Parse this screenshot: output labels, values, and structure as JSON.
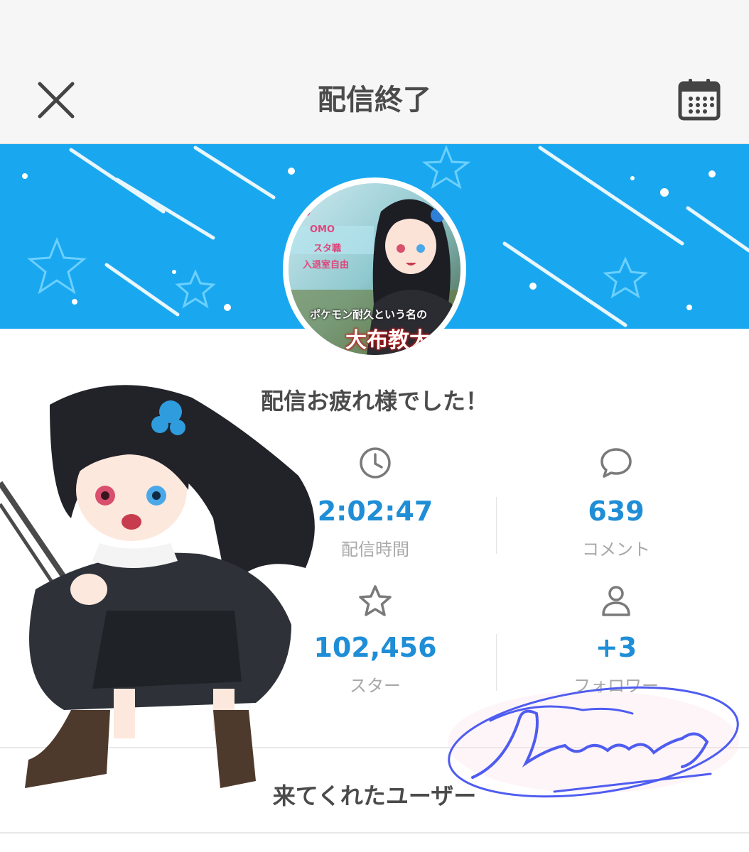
{
  "header": {
    "title": "配信終了",
    "close_icon": "close-icon",
    "calendar_icon": "calendar-icon"
  },
  "avatar": {
    "tags": [
      "O",
      "OMO",
      "スタ職",
      "入退室自由"
    ],
    "caption_small": "ポケモン耐久という名の",
    "caption_big": "大布教大"
  },
  "main": {
    "thanks_message": "配信お疲れ様でした！",
    "stats": [
      {
        "icon": "clock-icon",
        "value": "2:02:47",
        "label": "配信時間"
      },
      {
        "icon": "comment-icon",
        "value": "639",
        "label": "コメント"
      },
      {
        "icon": "star-icon",
        "value": "102,456",
        "label": "スター"
      },
      {
        "icon": "user-icon",
        "value": "+3",
        "label": "フォロワー"
      }
    ],
    "users_title": "来てくれたユーザー"
  },
  "colors": {
    "banner": "#19a8f0",
    "value": "#1f8ed6",
    "label": "#a8a8a8",
    "title": "#4b4b4b"
  }
}
